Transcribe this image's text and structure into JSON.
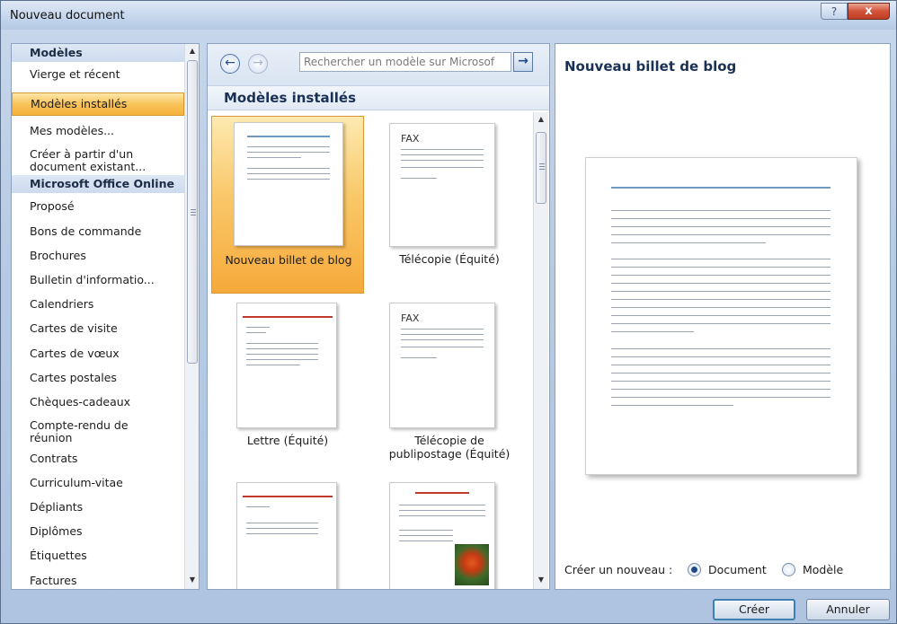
{
  "window": {
    "title": "Nouveau document",
    "help_glyph": "?",
    "close_glyph": "x"
  },
  "left": {
    "items": [
      {
        "label": "Modèles"
      },
      {
        "label": "Vierge et récent"
      },
      {
        "label": "Modèles installés"
      },
      {
        "label": "Mes modèles..."
      },
      {
        "label": "Créer à partir d'un document existant..."
      },
      {
        "label": "Microsoft Office Online"
      },
      {
        "label": "Proposé"
      },
      {
        "label": "Bons de commande"
      },
      {
        "label": "Brochures"
      },
      {
        "label": "Bulletin d'informatio..."
      },
      {
        "label": "Calendriers"
      },
      {
        "label": "Cartes de visite"
      },
      {
        "label": "Cartes de vœux"
      },
      {
        "label": "Cartes postales"
      },
      {
        "label": "Chèques-cadeaux"
      },
      {
        "label": "Compte-rendu de réunion"
      },
      {
        "label": "Contrats"
      },
      {
        "label": "Curriculum-vitae"
      },
      {
        "label": "Dépliants"
      },
      {
        "label": "Diplômes"
      },
      {
        "label": "Étiquettes"
      },
      {
        "label": "Factures"
      }
    ]
  },
  "middle": {
    "search_placeholder": "Rechercher un modèle sur Microsof",
    "back_glyph": "←",
    "forward_glyph": "→",
    "go_glyph": "→",
    "section_title": "Modèles installés",
    "templates": [
      {
        "label": "Nouveau billet de blog"
      },
      {
        "label": "Télécopie (Équité)"
      },
      {
        "label": "Lettre (Équité)"
      },
      {
        "label": "Télécopie de publipostage (Équité)"
      }
    ],
    "fax_text": "FAX"
  },
  "right": {
    "preview_title": "Nouveau billet de blog",
    "create_new_label": "Créer un nouveau :",
    "options": [
      {
        "label": "Document",
        "selected": true
      },
      {
        "label": "Modèle",
        "selected": false
      }
    ]
  },
  "buttons": {
    "create": "Créer",
    "cancel": "Annuler"
  }
}
